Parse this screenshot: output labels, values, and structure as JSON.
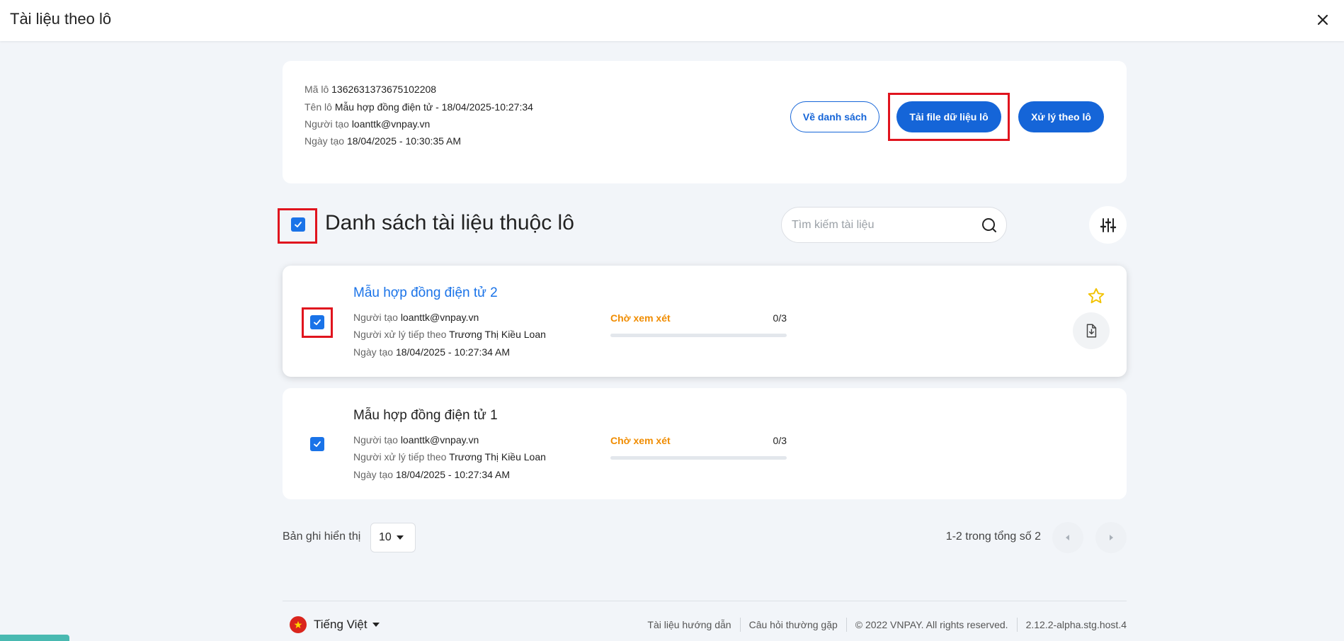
{
  "modal": {
    "title": "Tài liệu theo lô"
  },
  "batch": {
    "id_label": "Mã lô",
    "id_value": "1362631373675102208",
    "name_label": "Tên lô",
    "name_value": "Mẫu hợp đồng điện tử - 18/04/2025-10:27:34",
    "creator_label": "Người tạo",
    "creator_value": "loanttk@vnpay.vn",
    "date_label": "Ngày tạo",
    "date_value": "18/04/2025 - 10:30:35 AM"
  },
  "actions": {
    "back_label": "Về danh sách",
    "download_label": "Tải file dữ liệu lô",
    "process_label": "Xử lý theo lô"
  },
  "list": {
    "title": "Danh sách tài liệu thuộc lô",
    "search_placeholder": "Tìm kiếm tài liệu"
  },
  "documents": [
    {
      "title": "Mẫu hợp đồng điện tử 2",
      "creator_label": "Người tạo",
      "creator": "loanttk@vnpay.vn",
      "next_label": "Người xử lý tiếp theo",
      "next_handler": "Trương Thị Kiều Loan",
      "date_label": "Ngày tạo",
      "date": "18/04/2025 - 10:27:34 AM",
      "status": "Chờ xem xét",
      "progress_text": "0/3",
      "progress": 0
    },
    {
      "title": "Mẫu hợp đồng điện tử 1",
      "creator_label": "Người tạo",
      "creator": "loanttk@vnpay.vn",
      "next_label": "Người xử lý tiếp theo",
      "next_handler": "Trương Thị Kiều Loan",
      "date_label": "Ngày tạo",
      "date": "18/04/2025 - 10:27:34 AM",
      "status": "Chờ xem xét",
      "progress_text": "0/3",
      "progress": 0
    }
  ],
  "pagination": {
    "rows_label": "Bản ghi hiển thị",
    "rows_value": "10",
    "range_text": "1-2 trong tổng số 2"
  },
  "footer": {
    "language": "Tiếng Việt",
    "guide": "Tài liệu hướng dẫn",
    "faq": "Câu hỏi thường gặp",
    "copyright": "© 2022 VNPAY. All rights reserved.",
    "version": "2.12.2-alpha.stg.host.4"
  },
  "colors": {
    "primary": "#1565d8",
    "checkbox": "#1a73e8",
    "status_pending": "#f08c00",
    "highlight": "#e0141e",
    "star": "#f2c200"
  }
}
